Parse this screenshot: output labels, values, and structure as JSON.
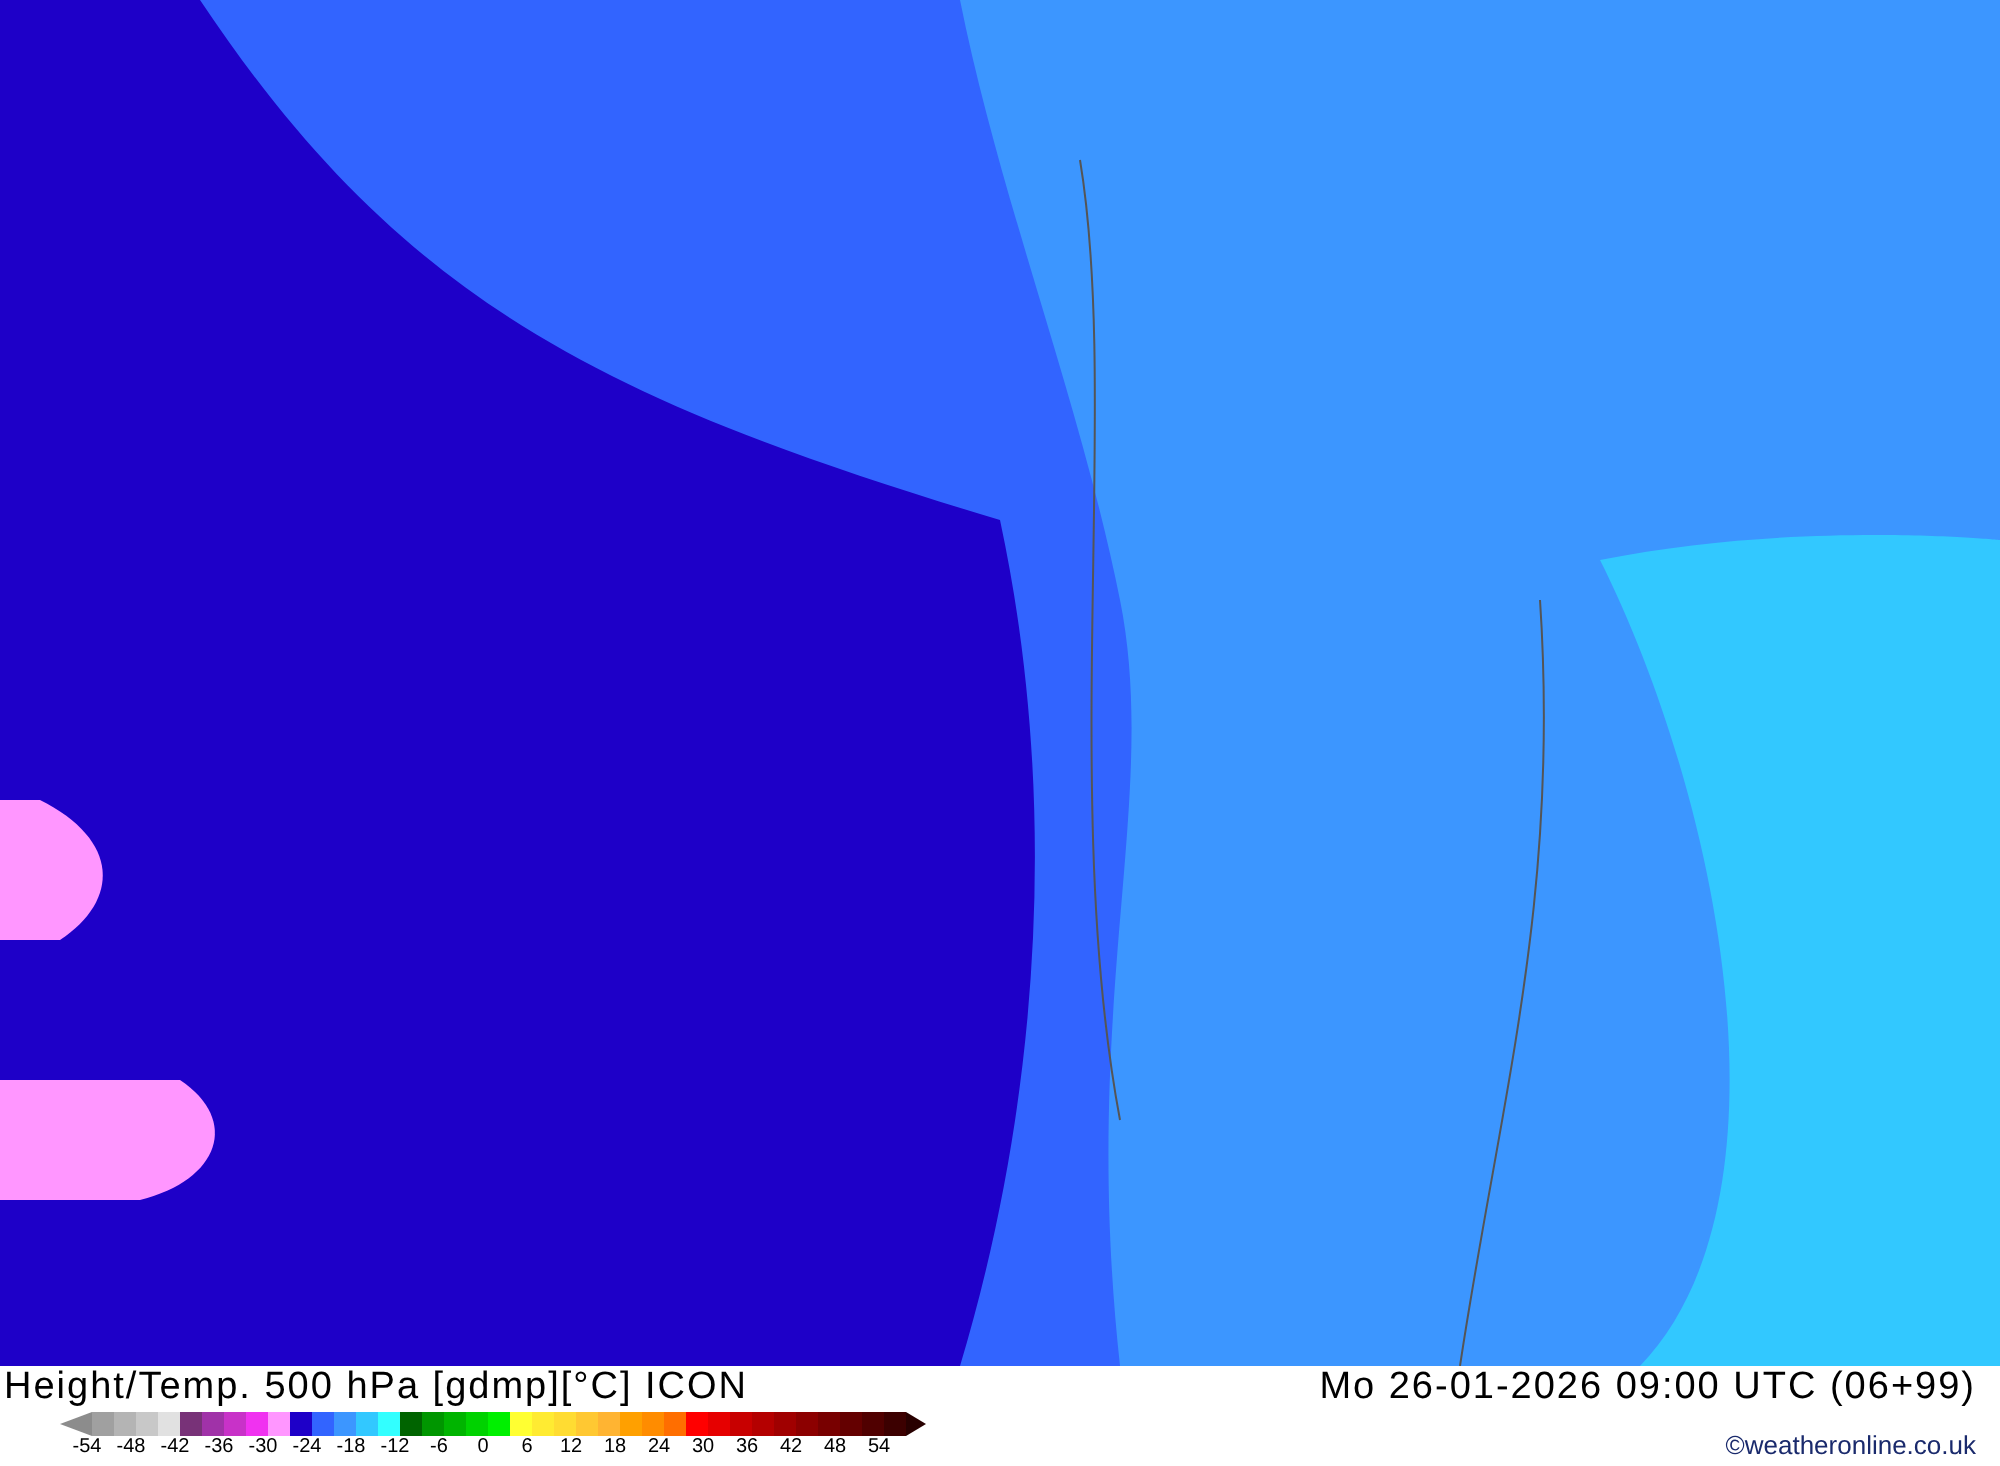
{
  "map": {
    "title": "Height/Temp. 500 hPa [gdmp][°C] ICON",
    "valid_time": "Mo 26-01-2026 09:00 UTC (06+99)"
  },
  "legend": {
    "swatches": [
      {
        "color": "#a0a0a0"
      },
      {
        "color": "#b4b4b4"
      },
      {
        "color": "#c8c8c8"
      },
      {
        "color": "#e1e1e1"
      },
      {
        "color": "#783278"
      },
      {
        "color": "#a032a8"
      },
      {
        "color": "#c832c8"
      },
      {
        "color": "#f032f0"
      },
      {
        "color": "#ff96ff"
      },
      {
        "color": "#1e00c8"
      },
      {
        "color": "#3264ff"
      },
      {
        "color": "#3c96ff"
      },
      {
        "color": "#32c8ff"
      },
      {
        "color": "#32ffff"
      },
      {
        "color": "#006400"
      },
      {
        "color": "#009600"
      },
      {
        "color": "#00b400"
      },
      {
        "color": "#00d200"
      },
      {
        "color": "#00f000"
      },
      {
        "color": "#ffff32"
      },
      {
        "color": "#ffeb32"
      },
      {
        "color": "#ffdc32"
      },
      {
        "color": "#ffc832"
      },
      {
        "color": "#ffb432"
      },
      {
        "color": "#ffa000"
      },
      {
        "color": "#ff8c00"
      },
      {
        "color": "#ff6e00"
      },
      {
        "color": "#ff0000"
      },
      {
        "color": "#e60000"
      },
      {
        "color": "#c80000"
      },
      {
        "color": "#b40000"
      },
      {
        "color": "#a00000"
      },
      {
        "color": "#8c0000"
      },
      {
        "color": "#780000"
      },
      {
        "color": "#640000"
      },
      {
        "color": "#500000"
      },
      {
        "color": "#3c0000"
      }
    ],
    "ticks": [
      "-54",
      "-48",
      "-42",
      "-36",
      "-30",
      "-24",
      "-18",
      "-12",
      "-6",
      "0",
      "6",
      "12",
      "18",
      "24",
      "30",
      "36",
      "42",
      "48",
      "54"
    ]
  },
  "copyright": "©weatheronline.co.uk"
}
